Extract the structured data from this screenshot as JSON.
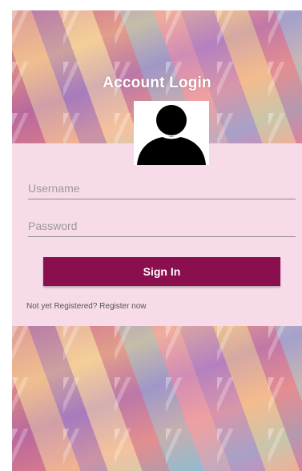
{
  "header": {
    "title": "Account Login"
  },
  "avatar": {
    "icon": "user-silhouette-icon"
  },
  "form": {
    "username": {
      "placeholder": "Username",
      "value": ""
    },
    "password": {
      "placeholder": "Password",
      "value": ""
    },
    "signin_label": "Sign In",
    "register_link": "Not yet Registered? Register now"
  },
  "colors": {
    "button": "#8b0f4e",
    "panel": "#f7dbe8"
  }
}
